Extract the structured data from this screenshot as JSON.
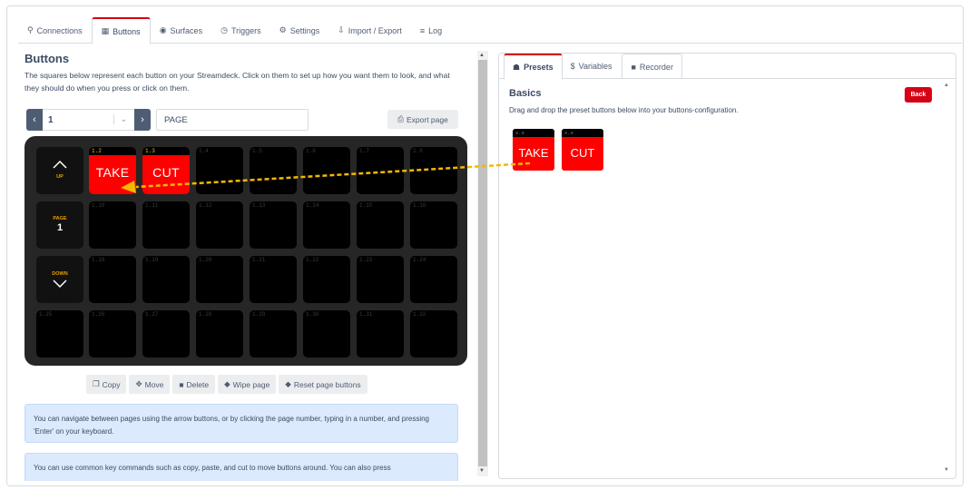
{
  "top_tabs": [
    {
      "label": "Connections",
      "icon": "plug-icon",
      "glyph": "⚲"
    },
    {
      "label": "Buttons",
      "icon": "grid-icon",
      "glyph": "▦"
    },
    {
      "label": "Surfaces",
      "icon": "gamepad-icon",
      "glyph": "◉"
    },
    {
      "label": "Triggers",
      "icon": "clock-icon",
      "glyph": "◷"
    },
    {
      "label": "Settings",
      "icon": "gear-icon",
      "glyph": "⚙"
    },
    {
      "label": "Import / Export",
      "icon": "file-import-icon",
      "glyph": "⇩"
    },
    {
      "label": "Log",
      "icon": "log-icon",
      "glyph": "≡"
    }
  ],
  "buttons_panel": {
    "title": "Buttons",
    "description": "The squares below represent each button on your Streamdeck. Click on them to set up how you want them to look, and what they should do when you press or click on them.",
    "page_number": "1",
    "page_name": "PAGE",
    "export_label": "Export page",
    "nav": {
      "up_label": "UP",
      "page_label": "PAGE",
      "page_value": "1",
      "down_label": "DOWN"
    },
    "keys": [
      {
        "id": "1.2",
        "text": "TAKE",
        "red": true
      },
      {
        "id": "1.3",
        "text": "CUT",
        "red": true
      },
      {
        "id": "1.4"
      },
      {
        "id": "1.5"
      },
      {
        "id": "1.6"
      },
      {
        "id": "1.7"
      },
      {
        "id": "1.8"
      },
      {
        "id": "1.10"
      },
      {
        "id": "1.11"
      },
      {
        "id": "1.12"
      },
      {
        "id": "1.13"
      },
      {
        "id": "1.14"
      },
      {
        "id": "1.15"
      },
      {
        "id": "1.16"
      },
      {
        "id": "1.18"
      },
      {
        "id": "1.19"
      },
      {
        "id": "1.20"
      },
      {
        "id": "1.21"
      },
      {
        "id": "1.22"
      },
      {
        "id": "1.23"
      },
      {
        "id": "1.24"
      },
      {
        "id": "1.25"
      },
      {
        "id": "1.26"
      },
      {
        "id": "1.27"
      },
      {
        "id": "1.28"
      },
      {
        "id": "1.29"
      },
      {
        "id": "1.30"
      },
      {
        "id": "1.31"
      },
      {
        "id": "1.32"
      }
    ],
    "actions": [
      {
        "label": "Copy",
        "icon": "copy-icon",
        "glyph": "❐"
      },
      {
        "label": "Move",
        "icon": "move-icon",
        "glyph": "✥"
      },
      {
        "label": "Delete",
        "icon": "trash-icon",
        "glyph": "■"
      },
      {
        "label": "Wipe page",
        "icon": "eraser-icon",
        "glyph": "◆"
      },
      {
        "label": "Reset page buttons",
        "icon": "eraser-icon",
        "glyph": "◆"
      }
    ],
    "info_1": "You can navigate between pages using the arrow buttons, or by clicking the page number, typing in a number, and pressing 'Enter' on your keyboard.",
    "info_2": "You can use common key commands such as copy, paste, and cut to move buttons around. You can also press"
  },
  "right_panel": {
    "tabs": [
      {
        "label": "Presets",
        "icon": "gift-icon",
        "glyph": "☗"
      },
      {
        "label": "Variables",
        "icon": "dollar-icon",
        "glyph": "$"
      },
      {
        "label": "Recorder",
        "icon": "video-icon",
        "glyph": "■"
      }
    ],
    "section_title": "Basics",
    "section_desc": "Drag and drop the preset buttons below into your buttons-configuration.",
    "back_label": "Back",
    "presets": [
      {
        "id": "x.x",
        "text": "TAKE"
      },
      {
        "id": "x.x",
        "text": "CUT"
      }
    ]
  },
  "colors": {
    "accent": "#d50215",
    "key_red": "#ff0000",
    "deck_bg": "#262626",
    "nav_label": "#e8a000",
    "drag_arrow": "#f5b800"
  }
}
